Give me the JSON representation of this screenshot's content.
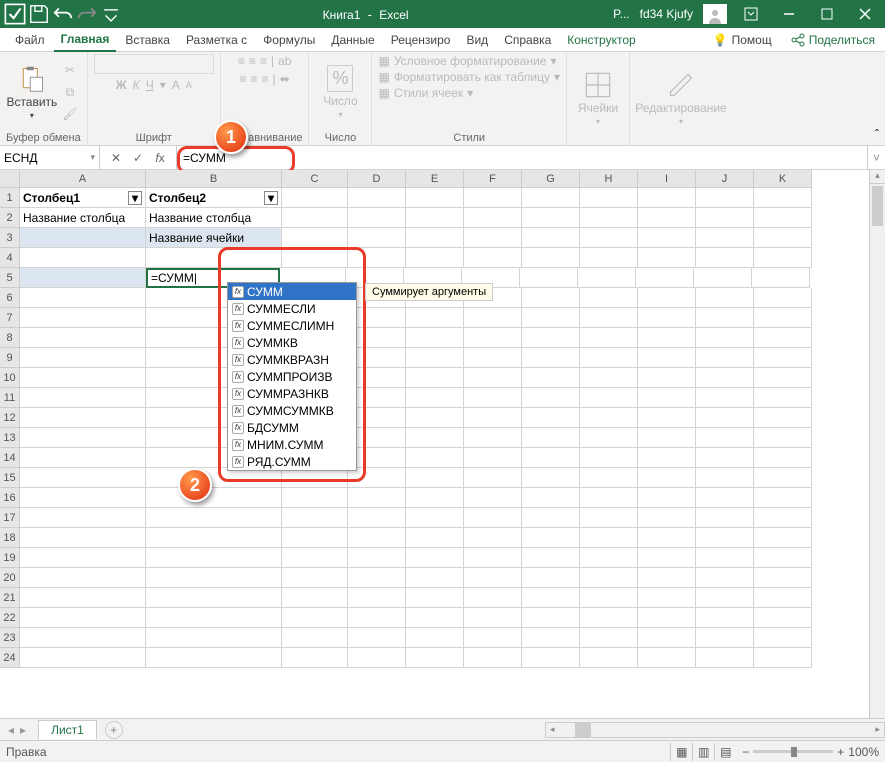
{
  "title": {
    "doc": "Книга1",
    "app": "Excel",
    "user_short": "P...",
    "user": "fd34 Kjufy"
  },
  "tabs": {
    "file": "Файл",
    "home": "Главная",
    "insert": "Вставка",
    "layout": "Разметка с",
    "formulas": "Формулы",
    "data": "Данные",
    "review": "Рецензиро",
    "view": "Вид",
    "help": "Справка",
    "design": "Конструктор",
    "tell": "Помощ",
    "share": "Поделиться"
  },
  "ribbon": {
    "clipboard": {
      "paste": "Вставить",
      "label": "Буфер обмена"
    },
    "font": {
      "letters": "Ж К Ч",
      "label": "Шрифт"
    },
    "align": {
      "label": "Выравнивание"
    },
    "number": {
      "btn": "Число",
      "label": "Число"
    },
    "styles": {
      "cond": "Условное форматирование",
      "table": "Форматировать как таблицу",
      "cellstyles": "Стили ячеек",
      "label": "Стили"
    },
    "cells": {
      "btn": "Ячейки"
    },
    "editing": {
      "btn": "Редактирование"
    }
  },
  "fbar": {
    "namebox": "ЕСНД",
    "formula": "=СУММ"
  },
  "columns": [
    "A",
    "B",
    "C",
    "D",
    "E",
    "F",
    "G",
    "H",
    "I",
    "J",
    "K"
  ],
  "rows": 24,
  "cells": {
    "A1": "Столбец1",
    "B1": "Столбец2",
    "A2": "Название столбца",
    "B2": "Название столбца",
    "B3": "Название ячейки",
    "B5_edit": "=СУММ"
  },
  "autocomplete": {
    "selected": 0,
    "tooltip": "Суммирует аргументы",
    "items": [
      "СУММ",
      "СУММЕСЛИ",
      "СУММЕСЛИМН",
      "СУММКВ",
      "СУММКВРАЗН",
      "СУММПРОИЗВ",
      "СУММРАЗНКВ",
      "СУММСУММКВ",
      "БДСУММ",
      "МНИМ.СУММ",
      "РЯД.СУММ"
    ]
  },
  "callouts": {
    "c1": "1",
    "c2": "2"
  },
  "sheets": {
    "tab1": "Лист1"
  },
  "status": {
    "mode": "Правка",
    "zoom": "100%"
  }
}
